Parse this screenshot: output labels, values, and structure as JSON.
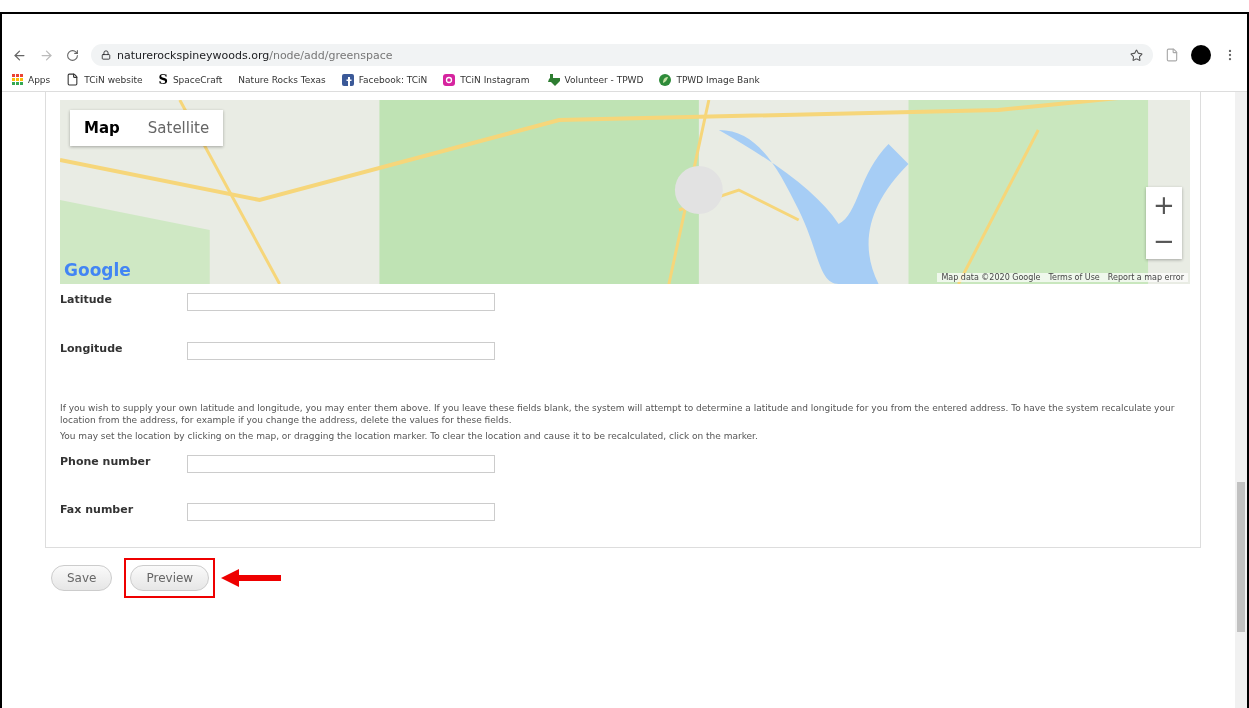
{
  "browser": {
    "url_domain": "naturerockspineywoods.org",
    "url_path": "/node/add/greenspace"
  },
  "bookmarks": [
    {
      "label": "Apps",
      "kind": "apps"
    },
    {
      "label": "TCiN website",
      "kind": "page"
    },
    {
      "label": "SpaceCraft",
      "kind": "letter",
      "icon_text": "S"
    },
    {
      "label": "Nature Rocks Texas",
      "kind": "none"
    },
    {
      "label": "Facebook: TCiN",
      "kind": "facebook"
    },
    {
      "label": "TCiN Instagram",
      "kind": "instagram"
    },
    {
      "label": "Volunteer - TPWD",
      "kind": "texas"
    },
    {
      "label": "TPWD Image Bank",
      "kind": "leaf"
    }
  ],
  "map": {
    "kind": "picture",
    "map_types": [
      {
        "label": "Map",
        "selected": true
      },
      {
        "label": "Satellite",
        "selected": false
      }
    ],
    "zoom_in": "+",
    "zoom_out": "−",
    "logo": "Google",
    "attribution": [
      "Map data ©2020 Google",
      "Terms of Use",
      "Report a map error"
    ]
  },
  "items": [
    {
      "kind": "field",
      "label": "Latitude"
    },
    {
      "kind": "field",
      "label": "Longitude"
    },
    {
      "kind": "help",
      "text": "If you wish to supply your own latitude and longitude, you may enter them above. If you leave these fields blank, the system will attempt to determine a latitude and longitude for you from the entered address. To have the system recalculate your location from the address, for example if you change the address, delete the values for these fields."
    },
    {
      "kind": "help",
      "text": "You may set the location by clicking on the map, or dragging the location marker. To clear the location and cause it to be recalculated, click on the marker."
    },
    {
      "kind": "field",
      "label": "Phone number"
    },
    {
      "kind": "field",
      "label": "Fax number"
    }
  ],
  "buttons": [
    {
      "label": "Save",
      "highlighted": false
    },
    {
      "label": "Preview",
      "highlighted": true
    }
  ]
}
